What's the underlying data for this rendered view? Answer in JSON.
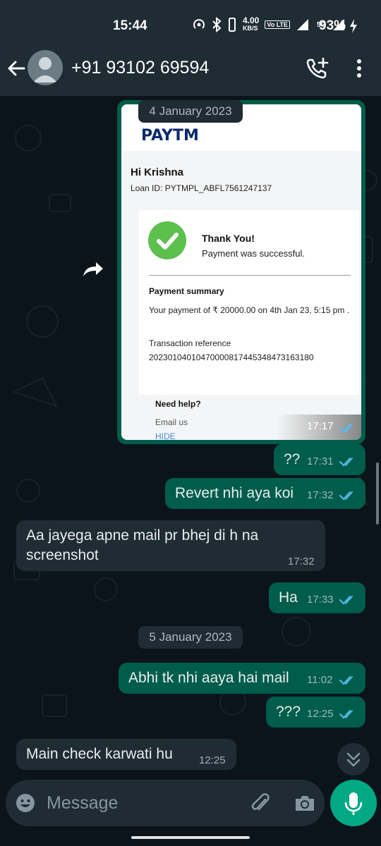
{
  "status_bar": {
    "time": "15:44",
    "speed": "4.00",
    "speed_unit": "KB/S",
    "volte": "Vo LTE",
    "sim": "1",
    "network": "5G",
    "battery": "93%",
    "icons": [
      "hotspot-icon",
      "bluetooth-icon",
      "vibrate-icon",
      "signal-icon",
      "charging-icon"
    ]
  },
  "header": {
    "contact": "+91 93102 69594",
    "icons": [
      "back-arrow-icon",
      "avatar",
      "add-call-icon",
      "more-vert-icon"
    ]
  },
  "chat": {
    "dates": [
      "4 January 2023",
      "5 January 2023"
    ],
    "image_message": {
      "time": "17:17",
      "status": "read",
      "content": {
        "greeting": "Hi Krishna",
        "loan_id": "Loan ID: PYTMPL_ABFL7561247137",
        "thank_you": "Thank You!",
        "payment_status": "Payment was successful.",
        "summary_title": "Payment summary",
        "summary_text": "Your payment of ₹ 20000.00 on 4th Jan 23, 5:15 pm .",
        "reference_label": "Transaction reference",
        "reference": "20230104010470000817445348473163180",
        "help": "Need help?",
        "email": "Email us",
        "hide": "HIDE"
      }
    },
    "messages": [
      {
        "dir": "out",
        "text": "??",
        "time": "17:31",
        "status": "read"
      },
      {
        "dir": "out",
        "text": "Revert nhi aya koi",
        "time": "17:32",
        "status": "read"
      },
      {
        "dir": "in",
        "text_line1": "Aa jayega apne mail pr bhej di h na",
        "text_line2": "screenshot",
        "time": "17:32"
      },
      {
        "dir": "out",
        "text": "Ha",
        "time": "17:33",
        "status": "read"
      },
      {
        "dir": "out",
        "text": "Abhi tk nhi aaya hai mail",
        "time": "11:02",
        "status": "read"
      },
      {
        "dir": "out",
        "text": "???",
        "time": "12:25",
        "status": "read"
      },
      {
        "dir": "in",
        "text": "Main check karwati hu",
        "time": "12:25"
      }
    ]
  },
  "composer": {
    "placeholder": "Message",
    "icons": [
      "emoji-icon",
      "attach-icon",
      "camera-icon",
      "mic-icon"
    ]
  },
  "colors": {
    "background": "#0b141a",
    "bar": "#1f2c34",
    "outgoing": "#005c4b",
    "incoming": "#1f2c34",
    "accent": "#00a884",
    "read_ticks": "#53bdeb"
  }
}
